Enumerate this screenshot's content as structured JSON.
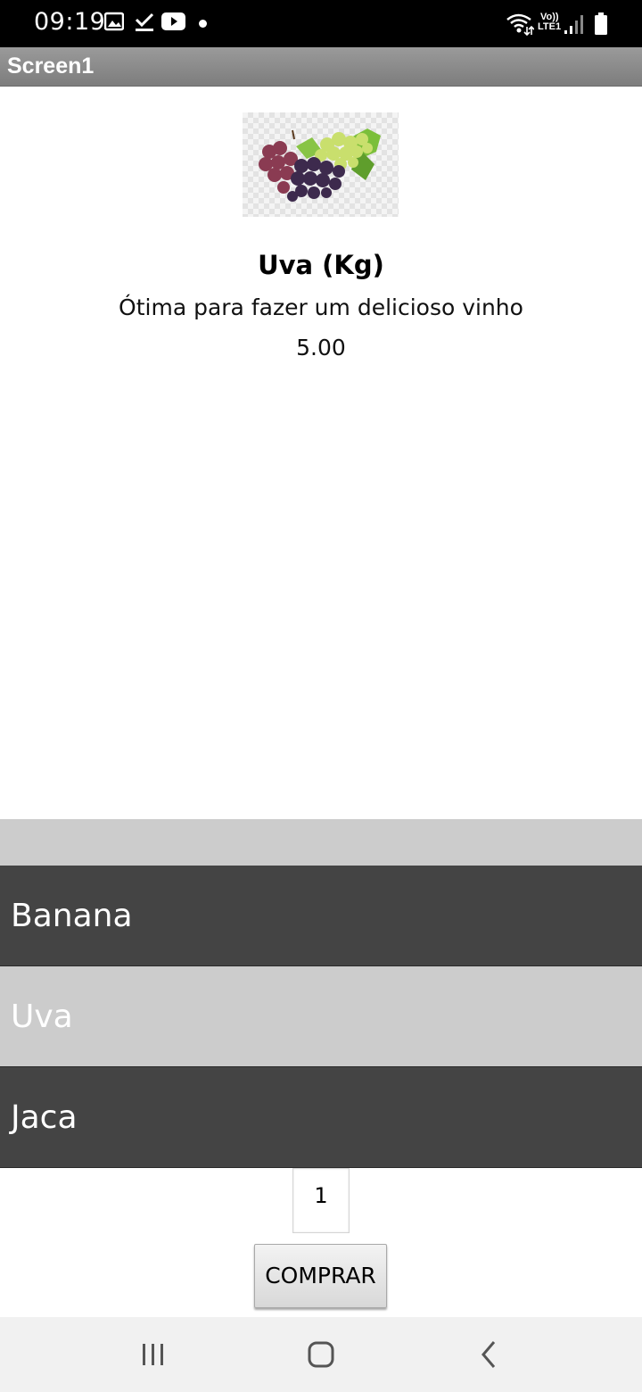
{
  "status_bar": {
    "time": "09:19",
    "left_icons": [
      "image-icon",
      "check-download-icon",
      "youtube-icon",
      "notification-dot-icon"
    ],
    "right_icons": [
      "wifi-icon",
      "volte-lte-icon",
      "signal-icon",
      "battery-icon"
    ],
    "network_label_top": "Vo))",
    "network_label_bottom": "LTE1"
  },
  "title_bar": {
    "title": "Screen1"
  },
  "product": {
    "image": "grapes-image",
    "name": "Uva (Kg)",
    "description": "Ótima para fazer um delicioso vinho",
    "price": "5.00"
  },
  "list": {
    "items": [
      {
        "label": "Banana",
        "style": "dark"
      },
      {
        "label": "Uva",
        "style": "light"
      },
      {
        "label": "Jaca",
        "style": "dark"
      }
    ]
  },
  "quantity": {
    "value": "1"
  },
  "buy_button": {
    "label": "COMPRAR"
  },
  "nav_bar": {
    "icons": [
      "recent-apps-icon",
      "home-icon",
      "back-icon"
    ]
  },
  "colors": {
    "status_bar_bg": "#000000",
    "title_bar_bg": "#8c8c8c",
    "list_dark": "#444444",
    "list_light": "#cccccc",
    "nav_bar_bg": "#f1f1f1"
  }
}
